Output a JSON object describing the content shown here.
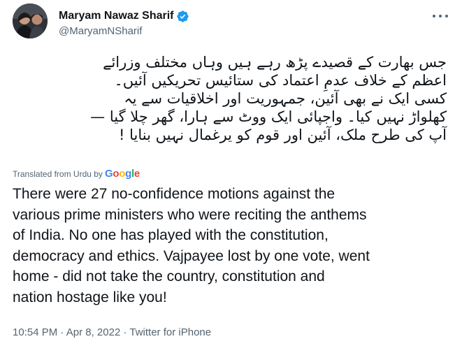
{
  "author": {
    "name": "Maryam Nawaz Sharif",
    "handle": "@MaryamNSharif",
    "verified": true
  },
  "icons": {
    "avatar": "profile-photo",
    "verified": "verified-badge-icon",
    "more": "more-options-icon"
  },
  "colors": {
    "verified_blue": "#1d9bf0",
    "text_primary": "#0f1419",
    "text_secondary": "#536471"
  },
  "original_text_lines": [
    "جس بھارت کے قصیدے پڑھ رہے ہیں وہاں مختلف وزرائے",
    "اعظم کے خلاف عدمِ اعتماد کی ستائیس تحریکیں آئیں۔",
    "کسی ایک نے بھی آئین، جمہوریت اور اخلاقیات سے یہ",
    "کھلواڑ نہیں کیا۔ واجپائی ایک ووٹ سے ہارا، گھر چلا گیا —",
    "آپ کی طرح ملک، آئین اور قوم کو یرغمال نہیں بنایا !"
  ],
  "translation": {
    "label": "Translated from Urdu by",
    "provider": "Google"
  },
  "translated_text_lines": [
    "There were 27 no-confidence motions against the",
    "various prime ministers who were reciting the anthems",
    "of India. No one has played with the constitution,",
    "democracy and ethics. Vajpayee lost by one vote, went",
    "home - did not take the country, constitution and",
    "nation hostage like you!"
  ],
  "meta": {
    "time": "10:54 PM",
    "separator": "·",
    "date": "Apr 8, 2022",
    "source": "Twitter for iPhone"
  }
}
